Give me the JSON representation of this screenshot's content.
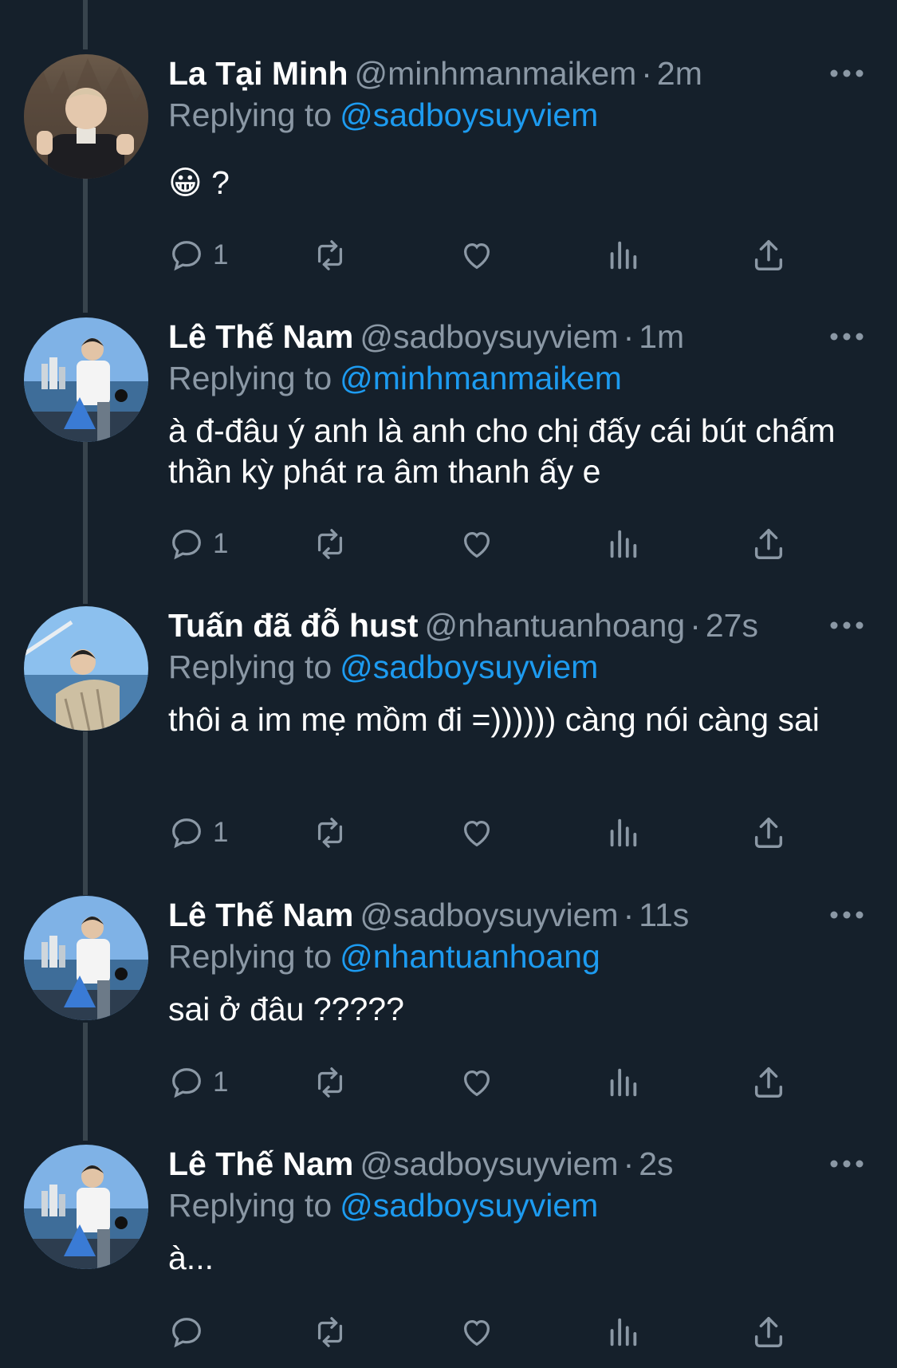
{
  "tweets": [
    {
      "name": "La Tại Minh",
      "handle": "@minhmanmaikem",
      "time": "2m",
      "replying_prefix": "Replying to",
      "replying_to": "@sadboysuyviem",
      "text": "😀 ?",
      "reply_count": "1",
      "avatar_icon": "avatar-photo-man-thumbs-up"
    },
    {
      "name": "Lê Thế Nam",
      "handle": "@sadboysuyviem",
      "time": "1m",
      "replying_prefix": "Replying to",
      "replying_to": "@minhmanmaikem",
      "text": "à đ-đâu ý anh là anh cho chị đấy cái bút chấm thần kỳ phát ra âm thanh ấy e",
      "reply_count": "1",
      "avatar_icon": "avatar-photo-man-on-boat"
    },
    {
      "name": "Tuấn đã đỗ hust",
      "handle": "@nhantuanhoang",
      "time": "27s",
      "replying_prefix": "Replying to",
      "replying_to": "@sadboysuyviem",
      "text": "thôi a im mẹ mồm đi =)))))) càng nói càng sai",
      "reply_count": "1",
      "avatar_icon": "avatar-photo-man-sea"
    },
    {
      "name": "Lê Thế Nam",
      "handle": "@sadboysuyviem",
      "time": "11s",
      "replying_prefix": "Replying to",
      "replying_to": "@nhantuanhoang",
      "text": "sai ở đâu ?????",
      "reply_count": "1",
      "avatar_icon": "avatar-photo-man-on-boat"
    },
    {
      "name": "Lê Thế Nam",
      "handle": "@sadboysuyviem",
      "time": "2s",
      "replying_prefix": "Replying to",
      "replying_to": "@sadboysuyviem",
      "text": "à...",
      "reply_count": "",
      "avatar_icon": "avatar-photo-man-on-boat"
    }
  ],
  "separator": "·",
  "colors": {
    "background": "#15202b",
    "muted": "#8b98a5",
    "link": "#1d9bf0",
    "thread_line": "#38444d"
  }
}
